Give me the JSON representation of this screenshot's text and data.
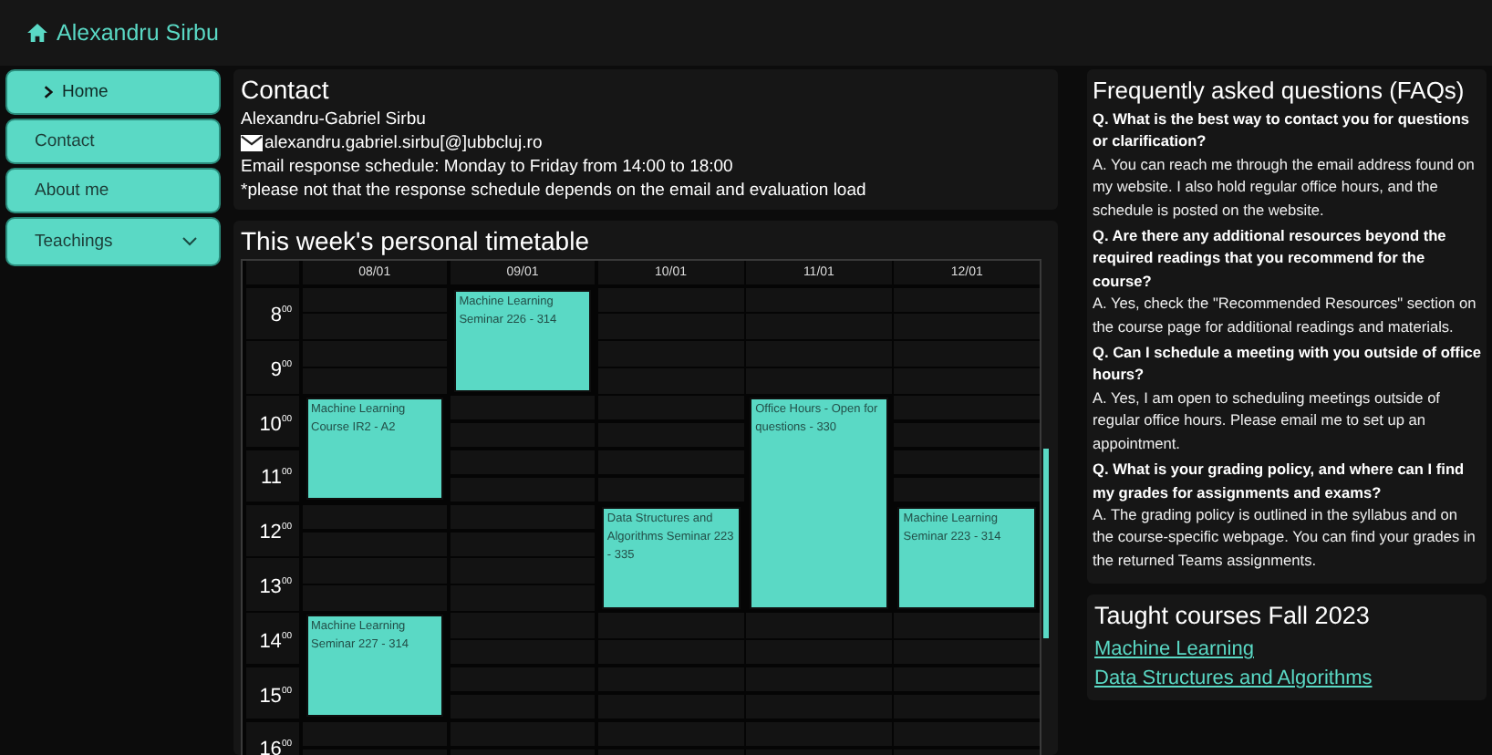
{
  "header": {
    "title": "Alexandru Sirbu"
  },
  "sidebar": {
    "items": [
      {
        "label": "Home",
        "selected": true
      },
      {
        "label": "Contact",
        "selected": false
      },
      {
        "label": "About me",
        "selected": false
      },
      {
        "label": "Teachings",
        "selected": false,
        "expanded": false
      }
    ]
  },
  "contact": {
    "title": "Contact",
    "name": "Alexandru-Gabriel Sirbu",
    "email": "alexandru.gabriel.sirbu[@]ubbcluj.ro",
    "schedule": "Email response schedule: Monday to Friday from 14:00 to 18:00",
    "note": "*please not that the response schedule depends on the email and evaluation load"
  },
  "timetable": {
    "title": "This week's personal timetable",
    "days": [
      "08/01",
      "09/01",
      "10/01",
      "11/01",
      "12/01"
    ],
    "rows": [
      {
        "hour": "8$^{00}$",
        "cells": [
          {
            "kind": "empty"
          },
          {
            "kind": "event",
            "title": "Machine Learning Seminar 226 - 314"
          },
          {
            "kind": "empty"
          },
          {
            "kind": "empty"
          },
          {
            "kind": "empty"
          }
        ]
      },
      {
        "hour": "9$^{00}$",
        "cells": [
          {
            "kind": "empty"
          },
          {
            "kind": "continued"
          },
          {
            "kind": "empty"
          },
          {
            "kind": "empty"
          },
          {
            "kind": "empty"
          }
        ]
      },
      {
        "hour": "10$^{00}$",
        "cells": [
          {
            "kind": "event",
            "title": "Machine Learning Course IR2 - A2"
          },
          {
            "kind": "empty"
          },
          {
            "kind": "empty"
          },
          {
            "kind": "event",
            "title": "Office Hours - Open for questions - 330"
          },
          {
            "kind": "empty"
          }
        ]
      },
      {
        "hour": "11$^{00}$",
        "cells": [
          {
            "kind": "continued"
          },
          {
            "kind": "empty"
          },
          {
            "kind": "empty"
          },
          {
            "kind": "continued"
          },
          {
            "kind": "empty"
          }
        ]
      },
      {
        "hour": "12$^{00}$",
        "cells": [
          {
            "kind": "empty"
          },
          {
            "kind": "empty"
          },
          {
            "kind": "event",
            "title": "Data Structures and Algorithms Seminar 223 - 335"
          },
          {
            "kind": "continued"
          },
          {
            "kind": "event",
            "title": "Machine Learning Seminar 223 - 314"
          }
        ]
      },
      {
        "hour": "13$^{00}$",
        "cells": [
          {
            "kind": "empty"
          },
          {
            "kind": "empty"
          },
          {
            "kind": "continued"
          },
          {
            "kind": "continued"
          },
          {
            "kind": "continued"
          }
        ]
      },
      {
        "hour": "14$^{00}$",
        "cells": [
          {
            "kind": "event",
            "title": "Machine Learning Seminar 227 - 314"
          },
          {
            "kind": "empty"
          },
          {
            "kind": "empty"
          },
          {
            "kind": "empty"
          },
          {
            "kind": "empty"
          }
        ]
      },
      {
        "hour": "15$^{00}$",
        "cells": [
          {
            "kind": "continued"
          },
          {
            "kind": "empty"
          },
          {
            "kind": "empty"
          },
          {
            "kind": "empty"
          },
          {
            "kind": "empty"
          }
        ]
      },
      {
        "hour": "16$^{00}$",
        "cells": [
          {
            "kind": "empty"
          },
          {
            "kind": "empty"
          },
          {
            "kind": "empty"
          },
          {
            "kind": "empty"
          },
          {
            "kind": "empty"
          }
        ]
      }
    ]
  },
  "faq": {
    "title": "Frequently asked questions (FAQs)",
    "items": [
      {
        "question": "Q. What is the best way to contact you for questions or clarification?",
        "answer": "A. You can reach me through the email address found on my website. I also hold regular office hours, and the schedule is posted on the website."
      },
      {
        "question": "Q. Are there any additional resources beyond the required readings that you recommend for the course?",
        "answer": "A. Yes, check the \"Recommended Resources\" section on the course page for additional readings and materials."
      },
      {
        "question": "Q. Can I schedule a meeting with you outside of office hours?",
        "answer": "A. Yes, I am open to scheduling meetings outside of regular office hours. Please email me to set up an appointment."
      },
      {
        "question": "Q. What is your grading policy, and where can I find my grades for assignments and exams?",
        "answer": "A. The grading policy is outlined in the syllabus and on the course-specific webpage. You can find your grades in the returned Teams assignments."
      }
    ]
  },
  "courses": {
    "title": "Taught courses Fall 2023",
    "links": [
      "Machine Learning",
      "Data Structures and Algorithms"
    ]
  }
}
